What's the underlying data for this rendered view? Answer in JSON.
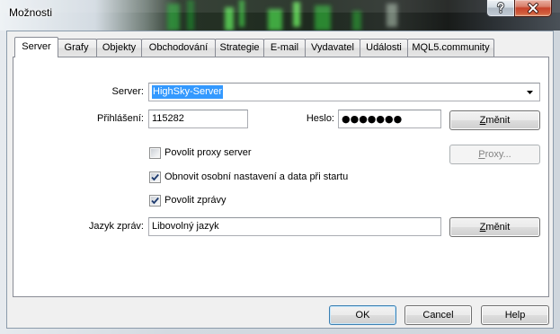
{
  "window": {
    "title": "Možnosti",
    "help_icon": "help-icon",
    "close_icon": "close-icon"
  },
  "tabs": [
    {
      "label": "Server",
      "selected": true
    },
    {
      "label": "Grafy",
      "selected": false
    },
    {
      "label": "Objekty",
      "selected": false
    },
    {
      "label": "Obchodování",
      "selected": false
    },
    {
      "label": "Strategie",
      "selected": false
    },
    {
      "label": "E-mail",
      "selected": false
    },
    {
      "label": "Vydavatel",
      "selected": false
    },
    {
      "label": "Události",
      "selected": false
    },
    {
      "label": "MQL5.community",
      "selected": false
    }
  ],
  "server_page": {
    "server": {
      "label": "Server:",
      "value": "HighSky-Server",
      "dropdown_icon": "dropdown-arrow-icon"
    },
    "login": {
      "label": "Přihlášení:",
      "value": "115282"
    },
    "password": {
      "label": "Heslo:",
      "value": "●●●●●●●"
    },
    "change_password_button": {
      "label": "Změnit"
    },
    "proxy_checkbox": {
      "label": "Povolit proxy server",
      "checked": false
    },
    "proxy_button": {
      "label": "Proxy...",
      "disabled": true
    },
    "restore_checkbox": {
      "label": "Obnovit osobní nastavení a data při startu",
      "checked": true
    },
    "news_checkbox": {
      "label": "Povolit zprávy",
      "checked": true
    },
    "news_language": {
      "label": "Jazyk zpráv:",
      "value": "Libovolný jazyk"
    },
    "change_language_button": {
      "label": "Změnit"
    }
  },
  "footer": {
    "ok_label": "OK",
    "cancel_label": "Cancel",
    "help_label": "Help"
  },
  "colors": {
    "selection_highlight": "#3399ff",
    "close_button": "#c7432b"
  }
}
